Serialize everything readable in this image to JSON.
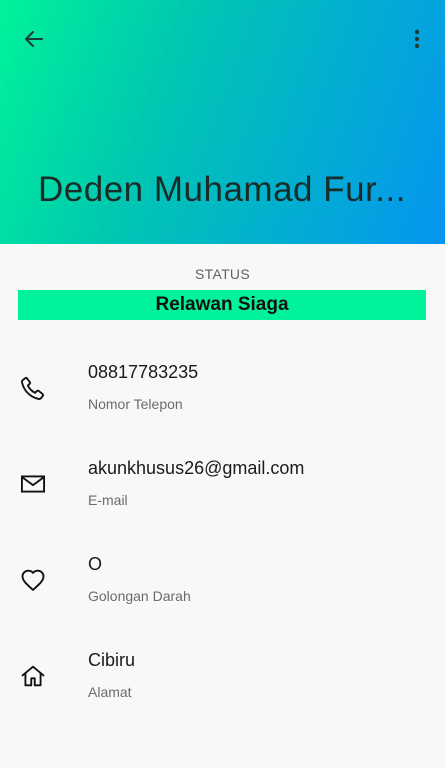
{
  "header": {
    "title": "Deden Muhamad Fur...",
    "back_icon": "arrow-left-icon",
    "menu_icon": "more-vert-icon",
    "gradient_start": "#00f39a",
    "gradient_end": "#0595f0"
  },
  "status": {
    "label": "STATUS",
    "value": "Relawan Siaga",
    "color": "#00f39a"
  },
  "details": [
    {
      "icon": "phone-icon",
      "value": "08817783235",
      "caption": "Nomor Telepon"
    },
    {
      "icon": "mail-icon",
      "value": "akunkhusus26@gmail.com",
      "caption": "E-mail"
    },
    {
      "icon": "heart-icon",
      "value": "O",
      "caption": "Golongan Darah"
    },
    {
      "icon": "home-icon",
      "value": "Cibiru",
      "caption": "Alamat"
    }
  ]
}
